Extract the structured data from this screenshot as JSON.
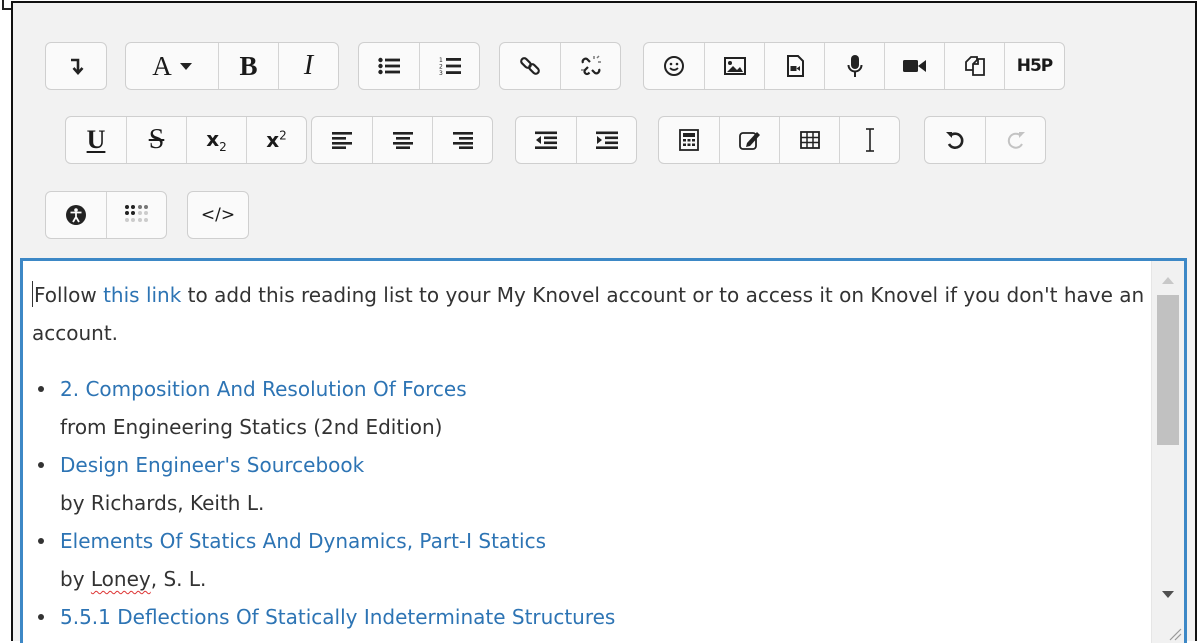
{
  "toolbar": {
    "rows": [
      [
        [
          "show-more-buttons-icon"
        ],
        [
          "font-color-dropdown-icon",
          "bold-icon",
          "italic-icon"
        ],
        [
          "unordered-list-icon",
          "ordered-list-icon"
        ],
        [
          "link-icon",
          "unlink-icon"
        ],
        [
          "emoji-icon",
          "image-icon",
          "media-icon",
          "record-audio-icon",
          "record-video-icon",
          "manage-files-icon",
          "h5p-icon"
        ]
      ],
      [
        [
          "underline-icon",
          "strikethrough-icon",
          "subscript-icon",
          "superscript-icon"
        ],
        [
          "align-left-icon",
          "align-center-icon",
          "align-right-icon"
        ],
        [
          "outdent-icon",
          "indent-icon"
        ],
        [
          "equation-icon",
          "character-map-icon",
          "table-icon",
          "clear-formatting-icon"
        ],
        [
          "undo-icon",
          "redo-icon"
        ]
      ],
      [
        [
          "accessibility-checker-icon",
          "screen-reader-helper-icon"
        ],
        [
          "html-source-icon"
        ]
      ]
    ],
    "glyphs": {
      "font_color": "A",
      "bold": "B",
      "italic": "I",
      "underline": "U",
      "strike": "S",
      "subscript_base": "x",
      "subscript_digit": "2",
      "superscript_base": "x",
      "superscript_digit": "2",
      "h5p": "H5P",
      "html": "</>"
    },
    "disabled": [
      "redo-icon"
    ]
  },
  "content": {
    "intro_before_link": "Follow ",
    "intro_link": "this link",
    "intro_after_link": " to add this reading list to your My Knovel account or to access it on Knovel if you don't have an account.",
    "items": [
      {
        "title": "2. Composition And Resolution Of Forces",
        "byline": "from Engineering Statics (2nd Edition)"
      },
      {
        "title": "Design Engineer's Sourcebook",
        "byline": "by Richards, Keith L."
      },
      {
        "title": "Elements Of Statics And Dynamics, Part-I Statics",
        "byline_prefix": "by ",
        "byline_flagged": "Loney",
        "byline_suffix": ", S. L."
      },
      {
        "title": "5.5.1 Deflections Of Statically Indeterminate Structures"
      }
    ]
  },
  "colors": {
    "link": "#2d74b4",
    "focus_border": "#3d88c6",
    "toolbar_bg": "#f2f2f2",
    "text": "#333333",
    "spellcheck": "#dd3333"
  },
  "scroll": {
    "position_fraction": 0.0,
    "visible_fraction": 0.45
  }
}
